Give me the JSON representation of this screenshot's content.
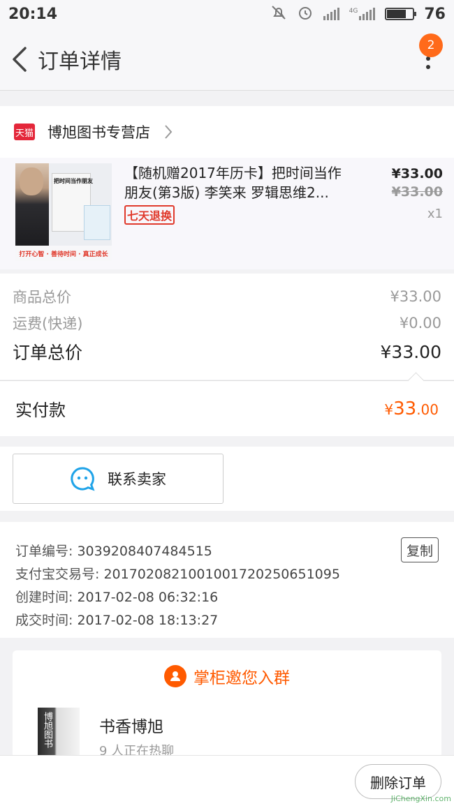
{
  "status_bar": {
    "time": "20:14",
    "network_label": "4G",
    "battery_level": "76",
    "battery_fill_fraction": 0.76
  },
  "header": {
    "title": "订单详情",
    "notification_count": "2"
  },
  "store": {
    "badge": "天猫",
    "name": "博旭图书专营店"
  },
  "product": {
    "title": "【随机赠2017年历卡】把时间当作朋友(第3版) 李笑来 罗辑思维2...",
    "tag": "七天退换",
    "price": "¥33.00",
    "original_price": "¥33.00",
    "quantity": "x1",
    "cover_title": "把时间当作朋友",
    "cover_caption": "打开心智 · 善待时间 · 真正成长"
  },
  "totals": {
    "goods_label": "商品总价",
    "goods_value": "¥33.00",
    "shipping_label": "运费(快递)",
    "shipping_value": "¥0.00",
    "order_total_label": "订单总价",
    "order_total_value": "¥33.00"
  },
  "paid": {
    "label": "实付款",
    "currency": "¥",
    "integer": "33",
    "decimal": ".00"
  },
  "contact": {
    "label": "联系卖家"
  },
  "order_info": {
    "order_no_label": "订单编号:",
    "order_no": "3039208407484515",
    "copy_label": "复制",
    "alipay_label": "支付宝交易号:",
    "alipay_no": "2017020821001001720250651095",
    "created_label": "创建时间:",
    "created": "2017-02-08 06:32:16",
    "closed_label": "成交时间:",
    "closed": "2017-02-08 18:13:27"
  },
  "group": {
    "invite": "掌柜邀您入群",
    "name": "书香博旭",
    "sub": "9 人正在热聊",
    "thumb_text": "博旭图书"
  },
  "bottom": {
    "delete_label": "删除订单"
  },
  "watermark": "JiChengXin.com",
  "colors": {
    "accent": "#ff5a00",
    "tmall_red": "#e4273a",
    "badge_orange": "#ff6a1a"
  }
}
